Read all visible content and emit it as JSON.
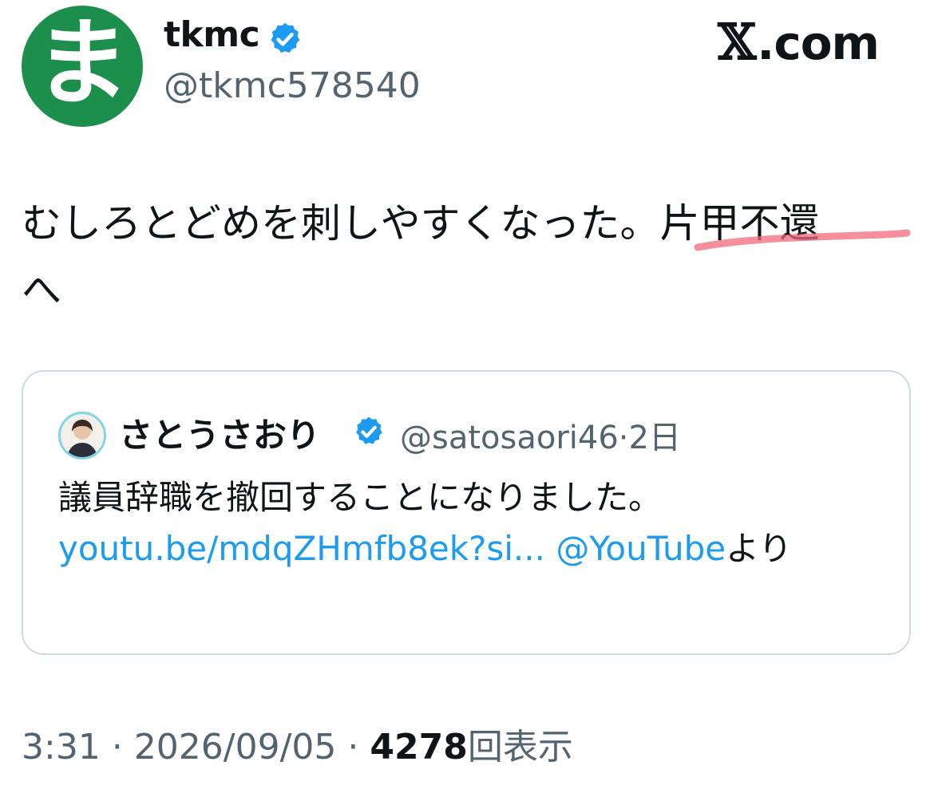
{
  "author": {
    "avatar_glyph": "ま",
    "avatar_color": "#1c8f4c",
    "display_name": "tkmc",
    "handle": "@tkmc578540",
    "verified": true
  },
  "brand": {
    "logo_x": "𝕏",
    "logo_text": ".com"
  },
  "tweet": {
    "text_part1": "むしろとどめを刺しやすくなった。",
    "text_highlight": "片甲不還",
    "text_part2": "へ"
  },
  "quote": {
    "display_name": "さとうさおり",
    "handle": "@satosaori46",
    "separator": "·",
    "age": "2日",
    "text": "議員辞職を撤回することになりました。",
    "link_url": "youtu.be/mdqZHmfb8ek?si...",
    "link_mention": "@YouTube",
    "suffix": "より"
  },
  "footer": {
    "time": "3:31",
    "date": "2026/09/05",
    "sep": "·",
    "views_count": "4278",
    "views_label": "回表示"
  },
  "colors": {
    "verified_badge": "#1d9bf0",
    "link": "#1d9bf0",
    "secondary_text": "#536471",
    "highlight_underline": "#f06a7a"
  }
}
